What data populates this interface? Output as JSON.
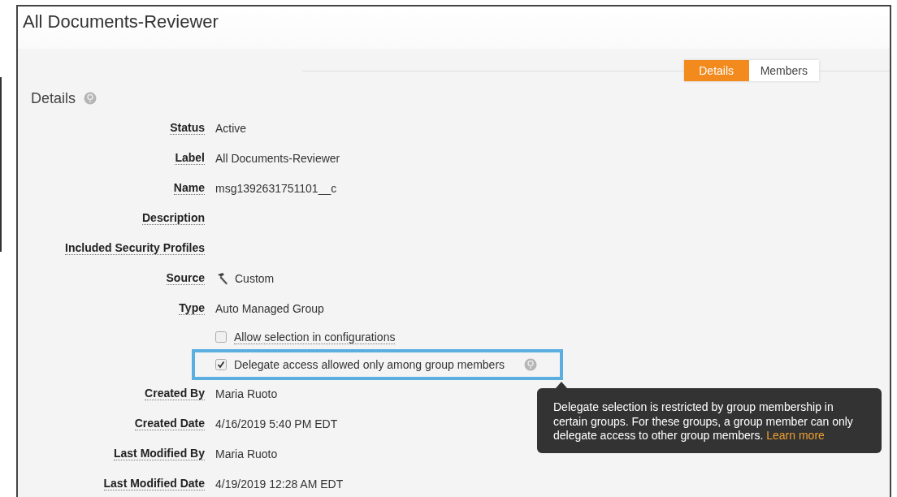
{
  "window": {
    "title": "All Documents-Reviewer"
  },
  "tabs": [
    {
      "label": "Details",
      "selected": true
    },
    {
      "label": "Members",
      "selected": false
    }
  ],
  "section": {
    "title": "Details"
  },
  "fields": [
    {
      "kind": "text",
      "label": "Status",
      "value": "Active"
    },
    {
      "kind": "text",
      "label": "Label",
      "value": "All Documents-Reviewer"
    },
    {
      "kind": "text",
      "label": "Name",
      "value": "msg1392631751101__c"
    },
    {
      "kind": "text",
      "label": "Description"
    },
    {
      "kind": "text",
      "label": "Included Security Profiles"
    },
    {
      "kind": "source",
      "label": "Source",
      "value": "Custom"
    },
    {
      "kind": "text",
      "label": "Type",
      "value": "Auto Managed Group"
    },
    {
      "kind": "checkbox",
      "label": "Allow selection in configurations",
      "checked": false,
      "highlighted": false,
      "help": false
    },
    {
      "kind": "checkbox",
      "label": "Delegate access allowed only among group members",
      "checked": true,
      "highlighted": true,
      "help": true
    },
    {
      "kind": "text",
      "label": "Created By",
      "value": "Maria Ruoto"
    },
    {
      "kind": "text",
      "label": "Created Date",
      "value": "4/16/2019 5:40 PM EDT"
    },
    {
      "kind": "text",
      "label": "Last Modified By",
      "value": "Maria Ruoto"
    },
    {
      "kind": "text",
      "label": "Last Modified Date",
      "value": "4/19/2019 12:28 AM EDT"
    }
  ],
  "tooltip": {
    "text": "Delegate selection is restricted by group membership in certain groups. For these groups, a group member can only delegate access to other group members.",
    "link": "Learn more"
  }
}
